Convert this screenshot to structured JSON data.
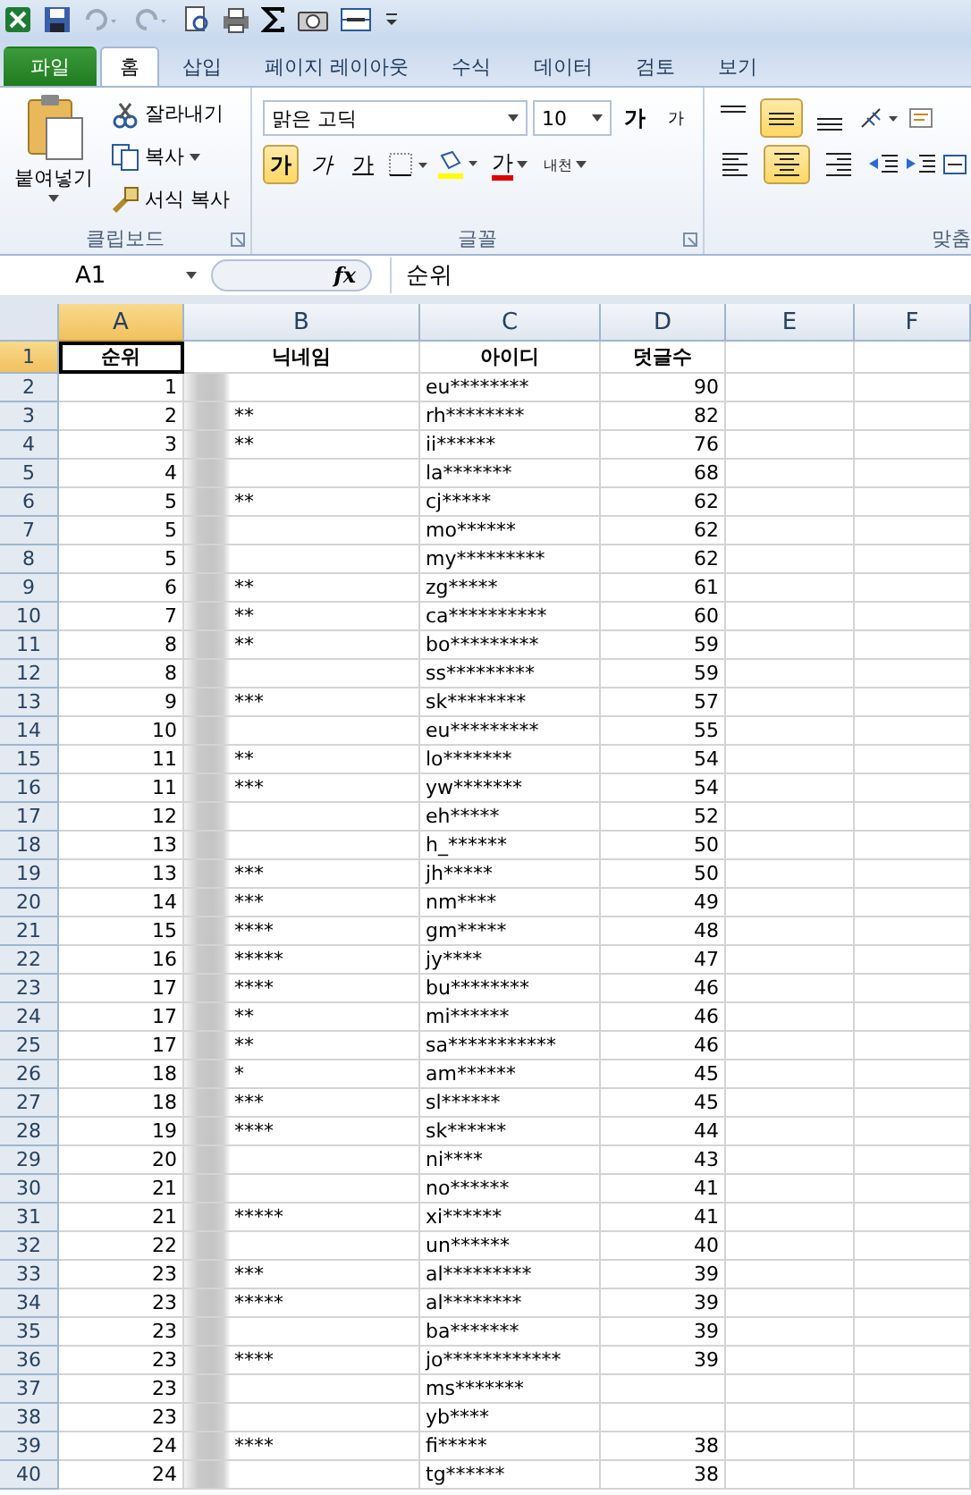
{
  "tabs": [
    {
      "label": "파일",
      "kind": "file",
      "selected": false
    },
    {
      "label": "홈",
      "kind": "tab",
      "selected": true
    },
    {
      "label": "삽입",
      "kind": "tab",
      "selected": false
    },
    {
      "label": "페이지 레이아웃",
      "kind": "tab",
      "selected": false
    },
    {
      "label": "수식",
      "kind": "tab",
      "selected": false
    },
    {
      "label": "데이터",
      "kind": "tab",
      "selected": false
    },
    {
      "label": "검토",
      "kind": "tab",
      "selected": false
    },
    {
      "label": "보기",
      "kind": "tab",
      "selected": false
    }
  ],
  "clipboard": {
    "label": "클립보드",
    "paste": "붙여넣기",
    "cut": "잘라내기",
    "copy": "복사",
    "format_painter": "서식 복사"
  },
  "font": {
    "label": "글꼴",
    "font_name": "맑은 고딕",
    "font_size": "10",
    "grow": "가",
    "shrink": "가",
    "font_color": "가",
    "phonetic": "내천",
    "styles": [
      {
        "label": "가",
        "kind": "bold",
        "selected": true
      },
      {
        "label": "가",
        "kind": "italic",
        "selected": false
      },
      {
        "label": "가",
        "kind": "underline",
        "selected": false
      }
    ]
  },
  "alignment": {
    "label": "맞춤",
    "vertical": [
      {
        "kind": "top",
        "selected": false
      },
      {
        "kind": "middle",
        "selected": true
      },
      {
        "kind": "bottom",
        "selected": false
      }
    ],
    "horizontal": [
      {
        "kind": "left",
        "selected": false
      },
      {
        "kind": "center",
        "selected": true
      },
      {
        "kind": "right",
        "selected": false
      }
    ]
  },
  "formula_bar": {
    "name_box": "A1",
    "function_label": "fx",
    "content": "순위"
  },
  "sheet": {
    "columns": [
      {
        "label": "A",
        "selected": true
      },
      {
        "label": "B",
        "selected": false
      },
      {
        "label": "C",
        "selected": false
      },
      {
        "label": "D",
        "selected": false
      },
      {
        "label": "E",
        "selected": false
      },
      {
        "label": "F",
        "selected": false
      }
    ],
    "rows": [
      {
        "n": "1",
        "selected": true,
        "kind": "header",
        "A": "순위",
        "B": "닉네임",
        "C": "아이디",
        "D": "덧글수"
      },
      {
        "n": "2",
        "selected": false,
        "A": "1",
        "C": "eu********",
        "D": "90"
      },
      {
        "n": "3",
        "selected": false,
        "A": "2",
        "B": "**",
        "C": "rh********",
        "D": "82"
      },
      {
        "n": "4",
        "selected": false,
        "A": "3",
        "B": "**",
        "C": "ii******",
        "D": "76"
      },
      {
        "n": "5",
        "selected": false,
        "A": "4",
        "C": "la*******",
        "D": "68"
      },
      {
        "n": "6",
        "selected": false,
        "A": "5",
        "B": "**",
        "C": "cj*****",
        "D": "62"
      },
      {
        "n": "7",
        "selected": false,
        "A": "5",
        "C": "mo******",
        "D": "62"
      },
      {
        "n": "8",
        "selected": false,
        "A": "5",
        "C": "my*********",
        "D": "62"
      },
      {
        "n": "9",
        "selected": false,
        "A": "6",
        "B": "**",
        "C": "zg*****",
        "D": "61"
      },
      {
        "n": "10",
        "selected": false,
        "A": "7",
        "B": "**",
        "C": "ca**********",
        "D": "60"
      },
      {
        "n": "11",
        "selected": false,
        "A": "8",
        "B": "**",
        "C": "bo*********",
        "D": "59"
      },
      {
        "n": "12",
        "selected": false,
        "A": "8",
        "C": "ss*********",
        "D": "59"
      },
      {
        "n": "13",
        "selected": false,
        "A": "9",
        "B": "***",
        "C": "sk********",
        "D": "57"
      },
      {
        "n": "14",
        "selected": false,
        "A": "10",
        "C": "eu*********",
        "D": "55"
      },
      {
        "n": "15",
        "selected": false,
        "A": "11",
        "B": "**",
        "C": "lo*******",
        "D": "54"
      },
      {
        "n": "16",
        "selected": false,
        "A": "11",
        "B": "***",
        "C": "yw*******",
        "D": "54"
      },
      {
        "n": "17",
        "selected": false,
        "A": "12",
        "C": "eh*****",
        "D": "52"
      },
      {
        "n": "18",
        "selected": false,
        "A": "13",
        "C": "h_******",
        "D": "50"
      },
      {
        "n": "19",
        "selected": false,
        "A": "13",
        "B": "***",
        "C": "jh*****",
        "D": "50"
      },
      {
        "n": "20",
        "selected": false,
        "A": "14",
        "B": "***",
        "C": "nm****",
        "D": "49"
      },
      {
        "n": "21",
        "selected": false,
        "A": "15",
        "B": "****",
        "C": "gm*****",
        "D": "48"
      },
      {
        "n": "22",
        "selected": false,
        "A": "16",
        "B": "*****",
        "C": "jy****",
        "D": "47"
      },
      {
        "n": "23",
        "selected": false,
        "A": "17",
        "B": "****",
        "C": "bu********",
        "D": "46"
      },
      {
        "n": "24",
        "selected": false,
        "A": "17",
        "B": "**",
        "C": "mi******",
        "D": "46"
      },
      {
        "n": "25",
        "selected": false,
        "A": "17",
        "B": "**",
        "C": "sa***********",
        "D": "46"
      },
      {
        "n": "26",
        "selected": false,
        "A": "18",
        "B": "*",
        "C": "am******",
        "D": "45"
      },
      {
        "n": "27",
        "selected": false,
        "A": "18",
        "B": "***",
        "C": "sl******",
        "D": "45"
      },
      {
        "n": "28",
        "selected": false,
        "A": "19",
        "B": "****",
        "C": "sk******",
        "D": "44"
      },
      {
        "n": "29",
        "selected": false,
        "A": "20",
        "C": "ni****",
        "D": "43"
      },
      {
        "n": "30",
        "selected": false,
        "A": "21",
        "C": "no******",
        "D": "41"
      },
      {
        "n": "31",
        "selected": false,
        "A": "21",
        "B": "*****",
        "C": "xi******",
        "D": "41"
      },
      {
        "n": "32",
        "selected": false,
        "A": "22",
        "C": "un******",
        "D": "40"
      },
      {
        "n": "33",
        "selected": false,
        "A": "23",
        "B": "***",
        "C": "al*********",
        "D": "39"
      },
      {
        "n": "34",
        "selected": false,
        "A": "23",
        "B": "*****",
        "C": "al********",
        "D": "39"
      },
      {
        "n": "35",
        "selected": false,
        "A": "23",
        "C": "ba*******",
        "D": "39"
      },
      {
        "n": "36",
        "selected": false,
        "A": "23",
        "B": "****",
        "C": "jo************",
        "D": "39"
      },
      {
        "n": "37",
        "selected": false,
        "A": "23",
        "C": "ms*******"
      },
      {
        "n": "38",
        "selected": false,
        "A": "23",
        "C": "yb****"
      },
      {
        "n": "39",
        "selected": false,
        "A": "24",
        "B": "****",
        "C": "fi*****",
        "D": "38"
      },
      {
        "n": "40",
        "selected": false,
        "A": "24",
        "C": "tg******",
        "D": "38"
      }
    ]
  }
}
